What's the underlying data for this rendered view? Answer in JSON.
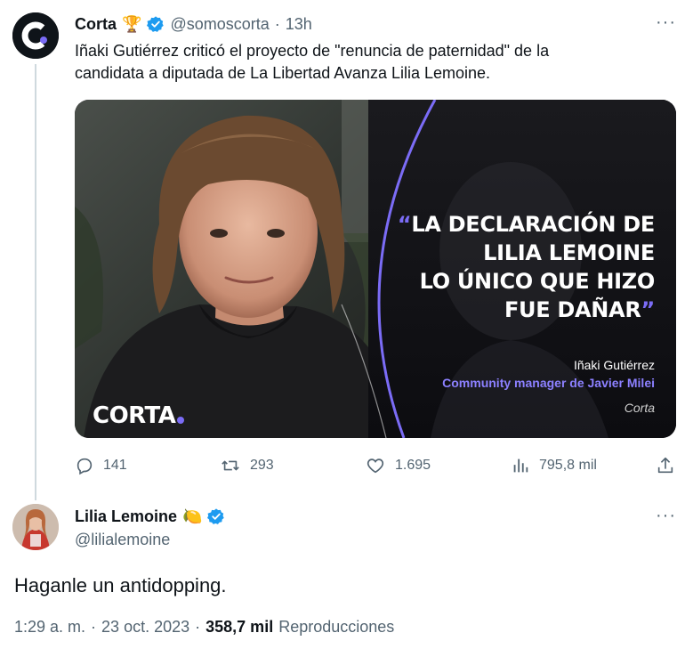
{
  "tweet1": {
    "name": "Corta",
    "name_emoji": "🏆",
    "handle": "@somoscorta",
    "time": "13h",
    "text_line1": "Iñaki Gutiérrez criticó el proyecto de \"renuncia de paternidad\" de la",
    "text_line2": "candidata a diputada de La Libertad Avanza Lilia Lemoine.",
    "media": {
      "quote_open": "“",
      "quote_line1": "LA DECLARACIÓN DE",
      "quote_line2": "LILIA LEMOINE",
      "quote_line3": "LO ÚNICO QUE HIZO",
      "quote_line4": "FUE DAÑAR",
      "quote_close": "”",
      "speaker": "Iñaki Gutiérrez",
      "speaker_role": "Community manager de Javier Milei",
      "source": "Corta",
      "logo": "CORTA",
      "accent": "#7b6cf6"
    },
    "actions": {
      "replies": "141",
      "retweets": "293",
      "likes": "1.695",
      "views": "795,8 mil"
    }
  },
  "tweet2": {
    "name": "Lilia Lemoine",
    "name_emoji": "🍋",
    "handle": "@lilialemoine",
    "text": "Haganle un antidopping.",
    "time": "1:29 a. m.",
    "date": "23 oct. 2023",
    "views_count": "358,7 mil",
    "views_label": "Reproducciones"
  },
  "more_label": "···",
  "colors": {
    "verified": "#1d9bf0",
    "secondary_text": "#536471",
    "primary_text": "#0f1419"
  }
}
